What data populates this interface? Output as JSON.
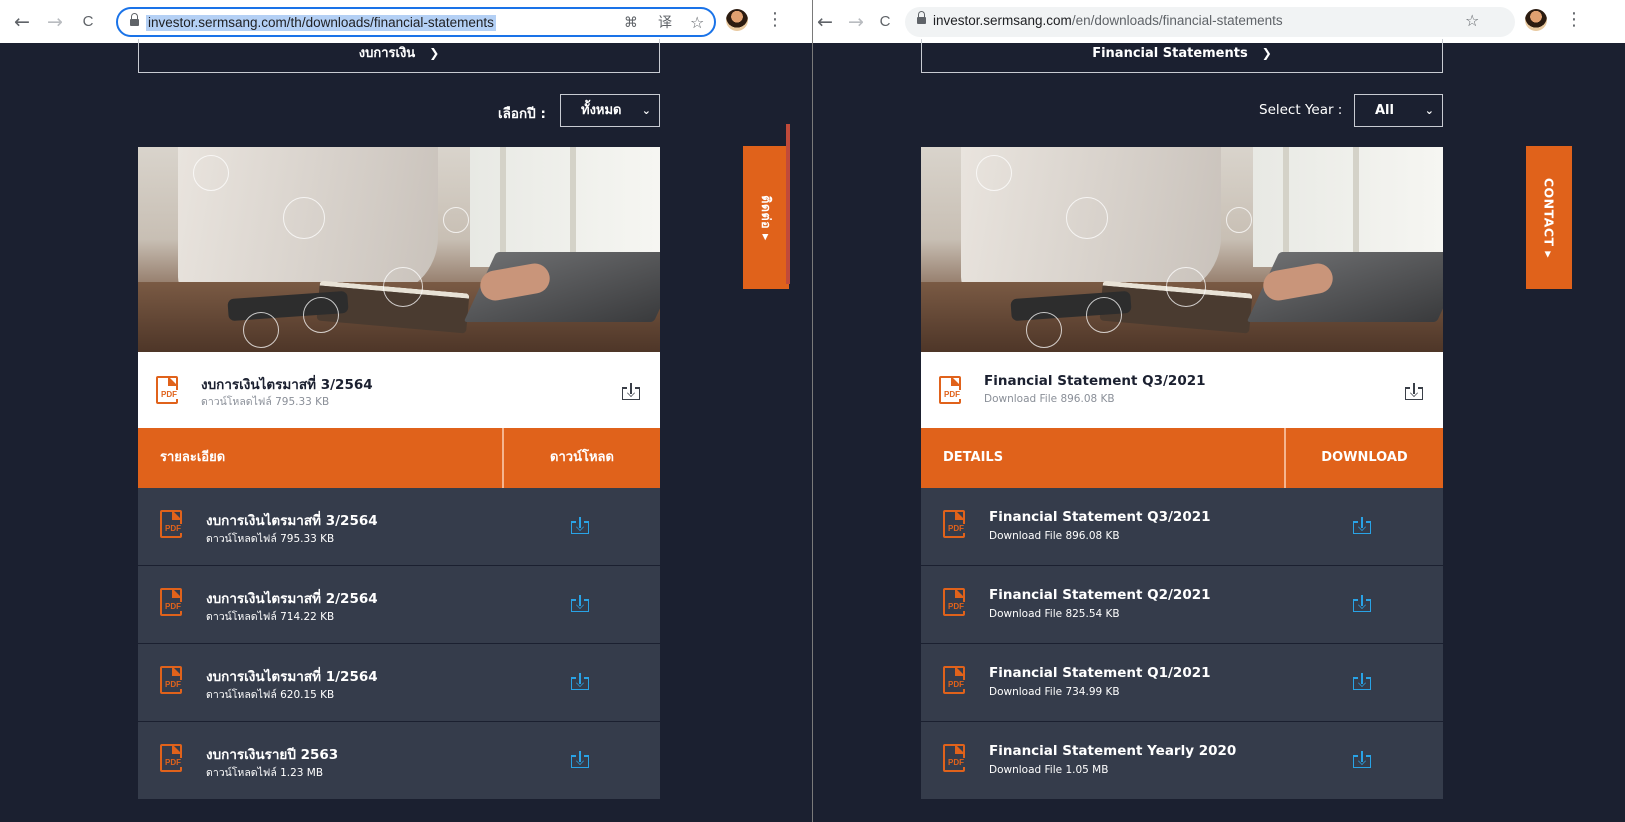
{
  "colors": {
    "page_bg": "#1b2030",
    "accent": "#e0621b",
    "row_bg": "#353c4b",
    "download_blue": "#29a3e6"
  },
  "icons": {
    "pdf": "pdf-file-icon",
    "download": "download-tray-icon",
    "lock": "lock-icon",
    "star": "star-icon"
  },
  "th": {
    "nav": {
      "back": "←",
      "forward": "→",
      "reload": "C"
    },
    "url": "investor.sermsang.com/th/downloads/financial-statements",
    "omni_icons": {
      "apps": "⌘",
      "translate": "译",
      "star": "☆"
    },
    "menu": "⋮",
    "section_dropdown": "งบการเงิน",
    "year_label": "เลือกปี :",
    "year_value": "ทั้งหมด",
    "contact_tab": "ติดต่อ ▸",
    "featured": {
      "title": "งบการเงินไตรมาสที่ 3/2564",
      "subtitle": "ดาวน์โหลดไฟล์ 795.33 KB",
      "pdf": "PDF"
    },
    "actions": {
      "details": "รายละเอียด",
      "download": "ดาวน์โหลด"
    },
    "rows": [
      {
        "title": "งบการเงินไตรมาสที่ 3/2564",
        "subtitle": "ดาวน์โหลดไฟล์ 795.33 KB",
        "pdf": "PDF"
      },
      {
        "title": "งบการเงินไตรมาสที่ 2/2564",
        "subtitle": "ดาวน์โหลดไฟล์ 714.22 KB",
        "pdf": "PDF"
      },
      {
        "title": "งบการเงินไตรมาสที่ 1/2564",
        "subtitle": "ดาวน์โหลดไฟล์ 620.15 KB",
        "pdf": "PDF"
      },
      {
        "title": "งบการเงินรายปี 2563",
        "subtitle": "ดาวน์โหลดไฟล์ 1.23 MB",
        "pdf": "PDF"
      }
    ]
  },
  "en": {
    "nav": {
      "back": "←",
      "forward": "→",
      "reload": "C"
    },
    "url_host": "investor.sermsang.com",
    "url_path": "/en/downloads/financial-statements",
    "omni_icons": {
      "star": "☆"
    },
    "menu": "⋮",
    "section_dropdown": "Financial Statements",
    "year_label": "Select Year :",
    "year_value": "All",
    "contact_tab": "CONTACT ▸",
    "featured": {
      "title": "Financial Statement Q3/2021",
      "subtitle": "Download File 896.08 KB",
      "pdf": "PDF"
    },
    "actions": {
      "details": "DETAILS",
      "download": "DOWNLOAD"
    },
    "rows": [
      {
        "title": "Financial Statement Q3/2021",
        "subtitle": "Download File 896.08 KB",
        "pdf": "PDF"
      },
      {
        "title": "Financial Statement Q2/2021",
        "subtitle": "Download File 825.54 KB",
        "pdf": "PDF"
      },
      {
        "title": "Financial Statement Q1/2021",
        "subtitle": "Download File 734.99 KB",
        "pdf": "PDF"
      },
      {
        "title": "Financial Statement Yearly 2020",
        "subtitle": "Download File 1.05 MB",
        "pdf": "PDF"
      }
    ]
  }
}
